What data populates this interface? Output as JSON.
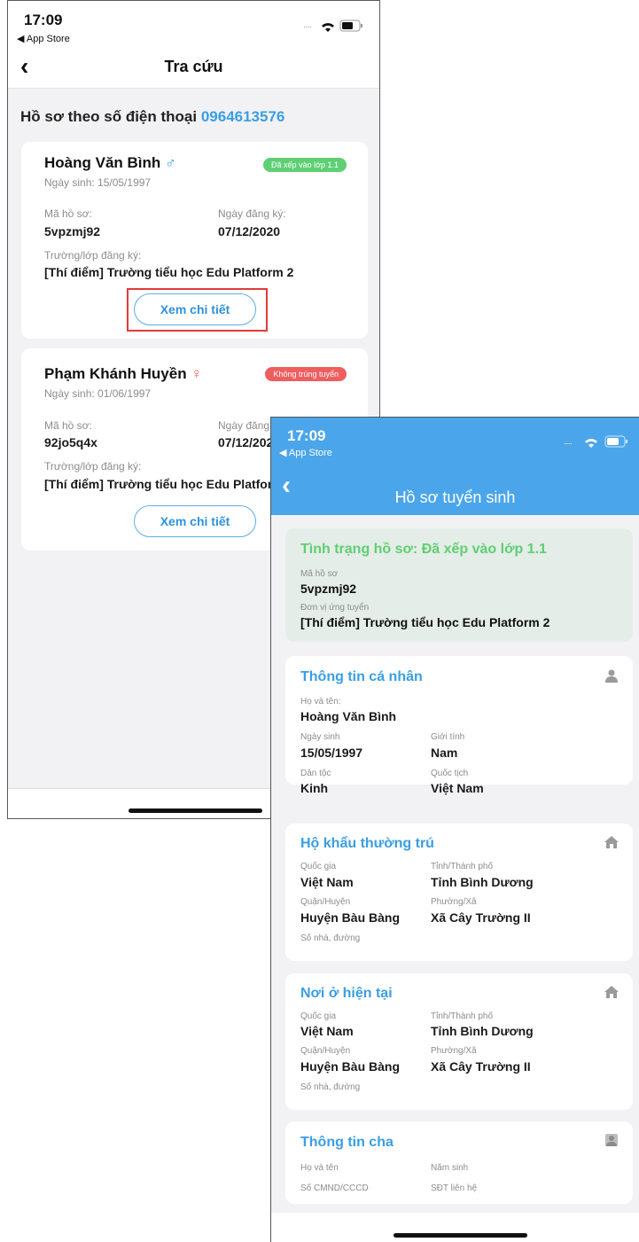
{
  "screen1": {
    "status": {
      "time": "17:09",
      "back_app": "◀ App Store",
      "signal": "....."
    },
    "nav": {
      "title": "Tra cứu"
    },
    "heading_prefix": "Hồ sơ theo số điện thoại ",
    "phone": "0964613576",
    "labels": {
      "profile_code": "Mã hồ sơ:",
      "reg_date": "Ngày đăng ký:",
      "school": "Trường/lớp đăng ký:",
      "detail": "Xem chi tiết"
    },
    "records": [
      {
        "name": "Hoàng Văn Bình",
        "gender_symbol": "♂",
        "dob": "Ngày sinh: 15/05/1997",
        "badge": "Đã xếp vào lớp 1.1",
        "code": "5vpzmj92",
        "reg_date": "07/12/2020",
        "school": "[Thí điểm] Trường tiểu học Edu Platform 2"
      },
      {
        "name": "Phạm Khánh Huyền",
        "gender_symbol": "♀",
        "dob": "Ngày sinh: 01/06/1997",
        "badge": "Không trúng tuyển",
        "code": "92jo5q4x",
        "reg_date": "07/12/2020",
        "school": "[Thí điểm] Trường tiểu học Edu Platform 2"
      }
    ],
    "colors": {
      "accent": "#3a9ee4",
      "badge_ok": "#5fcf73",
      "badge_fail": "#ef5e5e",
      "highlight": "#e03b3b"
    }
  },
  "screen2": {
    "status": {
      "time": "17:09",
      "back_app": "◀ App Store",
      "signal": "....."
    },
    "nav": {
      "title": "Hồ sơ tuyển sinh"
    },
    "status_card": {
      "title": "Tình trạng hồ sơ: Đã xếp vào lớp 1.1",
      "code_label": "Mã hồ sơ",
      "code": "5vpzmj92",
      "unit_label": "Đơn vị ứng tuyển",
      "unit": "[Thí điểm] Trường tiểu học Edu Platform 2"
    },
    "personal": {
      "title": "Thông tin cá nhân",
      "icon": "person-icon",
      "name_label": "Họ và tên:",
      "name": "Hoàng Văn Bình",
      "dob_label": "Ngày sinh",
      "dob": "15/05/1997",
      "gender_label": "Giới tính",
      "gender": "Nam",
      "ethnic_label": "Dân tộc",
      "ethnic": "Kinh",
      "nationality_label": "Quốc tịch",
      "nationality": "Việt Nam"
    },
    "permanent": {
      "title": "Hộ khẩu thường trú",
      "icon": "home-icon",
      "country_label": "Quốc gia",
      "country": "Việt Nam",
      "province_label": "Tỉnh/Thành phố",
      "province": "Tỉnh Bình Dương",
      "district_label": "Quận/Huyện",
      "district": "Huyện Bàu Bàng",
      "ward_label": "Phường/Xã",
      "ward": "Xã Cây Trường II",
      "street_label": "Số nhà, đường"
    },
    "current": {
      "title": "Nơi ở hiện tại",
      "icon": "home-icon",
      "country_label": "Quốc gia",
      "country": "Việt Nam",
      "province_label": "Tỉnh/Thành phố",
      "province": "Tỉnh Bình Dương",
      "district_label": "Quận/Huyện",
      "district": "Huyện Bàu Bàng",
      "ward_label": "Phường/Xã",
      "ward": "Xã Cây Trường II",
      "street_label": "Số nhà, đường"
    },
    "father": {
      "title": "Thông tin cha",
      "icon": "person-icon",
      "name_label": "Họ và tên",
      "birth_year_label": "Năm sinh",
      "id_label": "Số CMND/CCCD",
      "phone_label": "SĐT liên hệ"
    },
    "colors": {
      "header": "#4ba5ea",
      "status_green": "#5fcf73",
      "status_bg": "#e4ede7"
    }
  }
}
